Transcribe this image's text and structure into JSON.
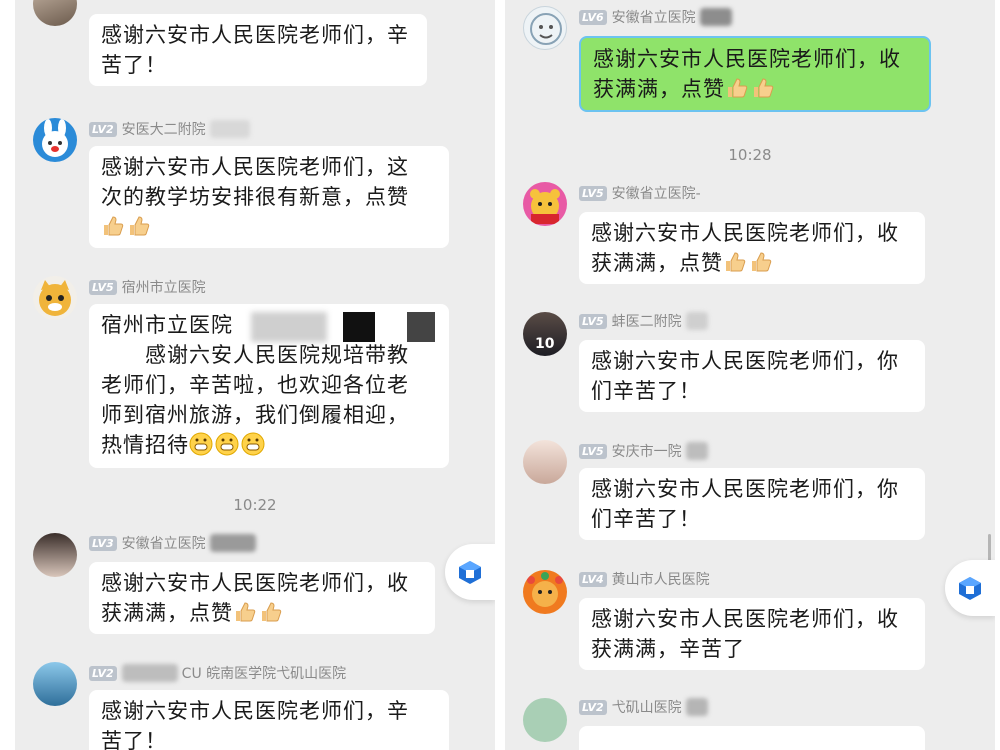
{
  "left": {
    "msg0": {
      "text_line1": "感谢六安市人民医院老师们，辛",
      "text_line2": "苦了！"
    },
    "msg1": {
      "level": "LV2",
      "sender": "安医大二附院",
      "text_line1": "感谢六安市人民医院老师们，这",
      "text_line2": "次的教学坊安排很有新意，点赞"
    },
    "msg2": {
      "level": "LV5",
      "sender": "宿州市立医院",
      "text_line1": "宿州市立医院",
      "text_line2": "感谢六安人民医院规培带教",
      "text_line3": "老师们，辛苦啦，也欢迎各位老",
      "text_line4": "师到宿州旅游，我们倒履相迎，",
      "text_line5": "热情招待"
    },
    "time1": "10:22",
    "msg3": {
      "level": "LV3",
      "sender": "安徽省立医院",
      "text_line1": "感谢六安市人民医院老师们，收",
      "text_line2": "获满满，点赞"
    },
    "msg4": {
      "level": "LV2",
      "sender": "CU 皖南医学院弋矶山医院",
      "text_line1": "感谢六安市人民医院老师们，辛",
      "text_line2": "苦了！"
    }
  },
  "right": {
    "msg0": {
      "level": "LV6",
      "sender": "安徽省立医院",
      "text_line1": "感谢六安市人民医院老师们，收",
      "text_line2": "获满满，点赞"
    },
    "time1": "10:28",
    "msg1": {
      "level": "LV5",
      "sender": "安徽省立医院-",
      "text_line1": "感谢六安市人民医院老师们，收",
      "text_line2": "获满满，点赞"
    },
    "msg2": {
      "level": "LV5",
      "sender": "蚌医二附院",
      "text_line1": "感谢六安市人民医院老师们，你",
      "text_line2": "们辛苦了！"
    },
    "msg3": {
      "level": "LV5",
      "sender": "安庆市一院",
      "text_line1": "感谢六安市人民医院老师们，你",
      "text_line2": "们辛苦了！"
    },
    "msg4": {
      "level": "LV4",
      "sender": "黄山市人民医院",
      "text_line1": "感谢六安市人民医院老师们，收",
      "text_line2": "获满满，辛苦了"
    },
    "msg5": {
      "level": "LV2",
      "sender": "弋矶山医院"
    }
  },
  "icons": {
    "thumbs": "thumbs-up-emoji",
    "grin": "grinning-emoji",
    "fab": "cube-app-icon"
  },
  "colors": {
    "panel_bg": "#ededed",
    "bubble": "#ffffff",
    "green_bubble": "#8fe36a",
    "accent": "#1f6fd6"
  }
}
